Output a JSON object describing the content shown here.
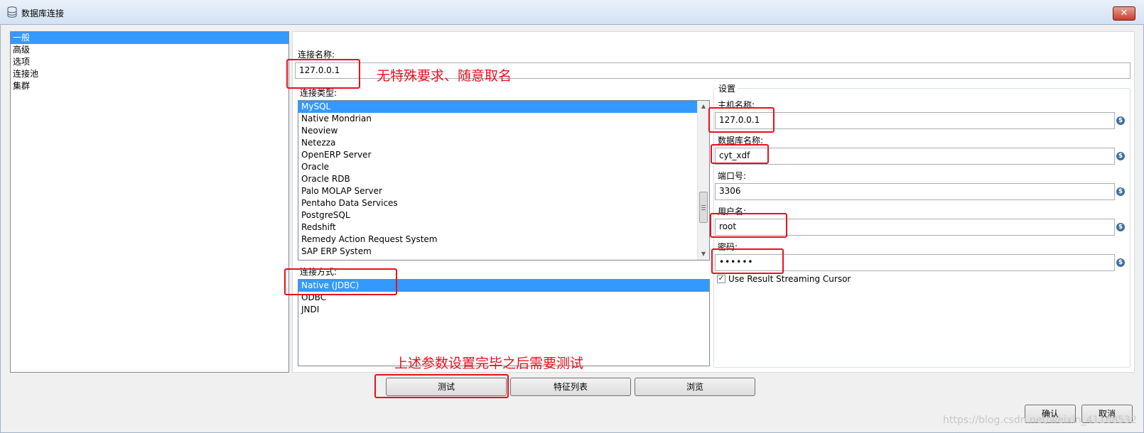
{
  "window": {
    "title": "数据库连接",
    "close_glyph": "✕"
  },
  "nav": {
    "items": [
      "一般",
      "高级",
      "选项",
      "连接池",
      "集群"
    ],
    "selected_index": 0
  },
  "connection": {
    "name_label": "连接名称:",
    "name_value": "127.0.0.1",
    "type_label": "连接类型:",
    "types": [
      "MySQL",
      "Native Mondrian",
      "Neoview",
      "Netezza",
      "OpenERP Server",
      "Oracle",
      "Oracle RDB",
      "Palo MOLAP Server",
      "Pentaho Data Services",
      "PostgreSQL",
      "Redshift",
      "Remedy Action Request System",
      "SAP ERP System"
    ],
    "selected_type": "MySQL",
    "method_label": "连接方式:",
    "methods": [
      "Native (JDBC)",
      "ODBC",
      "JNDI"
    ],
    "selected_method": "Native (JDBC)"
  },
  "settings": {
    "legend": "设置",
    "host_label": "主机名称:",
    "host_value": "127.0.0.1",
    "db_label": "数据库名称:",
    "db_value": "cyt_xdf",
    "port_label": "端口号:",
    "port_value": "3306",
    "user_label": "用户名:",
    "user_value": "root",
    "password_label": "密码:",
    "password_value": "••••••",
    "streaming_cursor_label": "Use Result Streaming Cursor",
    "streaming_cursor_checked": true,
    "var_icon_glyph": "$"
  },
  "buttons": {
    "test": "测试",
    "features": "特征列表",
    "explore": "浏览",
    "ok": "确认",
    "cancel": "取消"
  },
  "annotations": {
    "name_note": "无特殊要求、随意取名",
    "test_note": "上述参数设置完毕之后需要测试"
  },
  "watermark": "https://blog.csdn.net/weixin_41168532",
  "colors": {
    "selection": "#3399ff",
    "annotation_red": "#e8101f"
  }
}
